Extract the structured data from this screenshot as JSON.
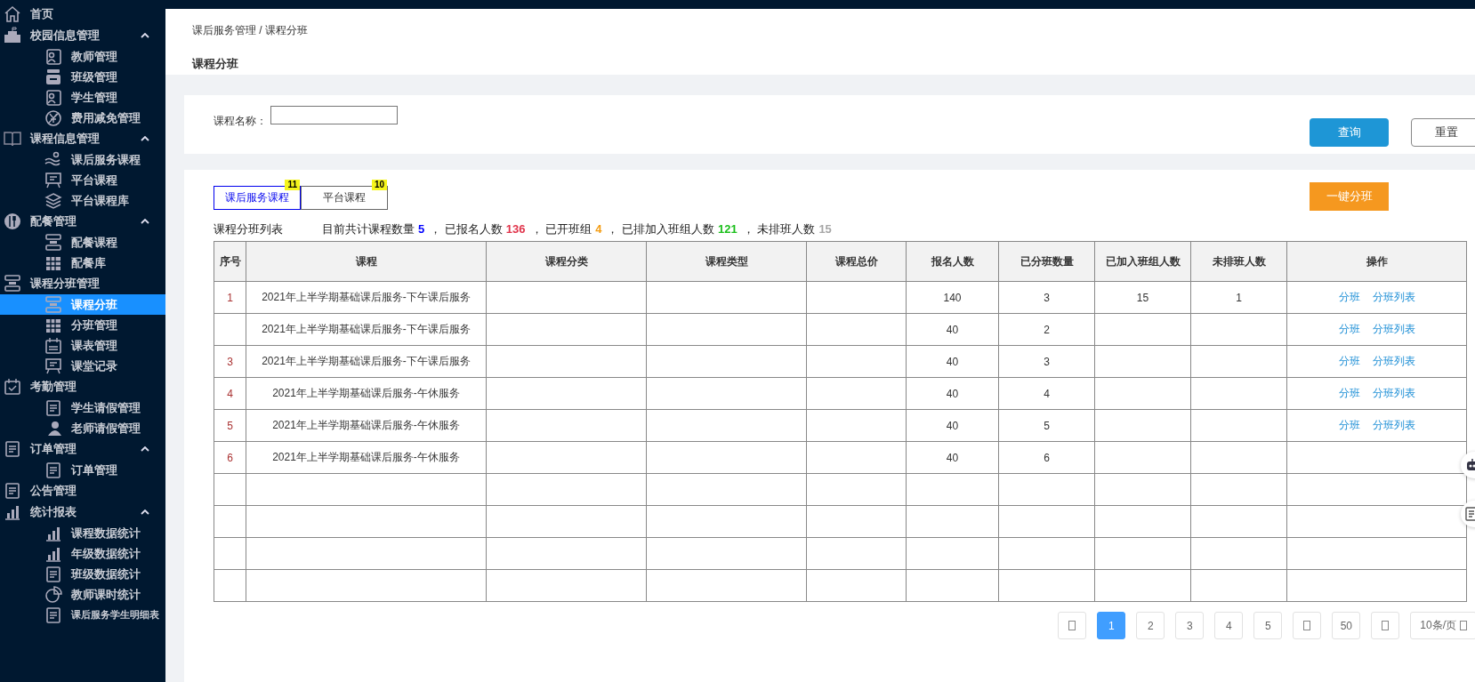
{
  "sidebar": {
    "items": [
      {
        "label": "首页"
      },
      {
        "label": "校园信息管理",
        "expanded": true,
        "children": [
          {
            "label": "教师管理",
            "selected": false
          },
          {
            "label": "班级管理",
            "selected": false
          },
          {
            "label": "学生管理",
            "selected": false
          },
          {
            "label": "费用减免管理",
            "selected": false
          }
        ]
      },
      {
        "label": "课程信息管理",
        "expanded": true,
        "children": [
          {
            "label": "课后服务课程",
            "selected": false
          },
          {
            "label": "平台课程",
            "selected": false
          },
          {
            "label": "平台课程库",
            "selected": false
          }
        ]
      },
      {
        "label": "配餐管理",
        "expanded": true,
        "children": [
          {
            "label": "配餐课程",
            "selected": false
          },
          {
            "label": "配餐库",
            "selected": false
          }
        ]
      },
      {
        "label": "课程分班管理",
        "children": [
          {
            "label": "课程分班",
            "selected": true
          },
          {
            "label": "分班管理",
            "selected": false
          },
          {
            "label": "课表管理",
            "selected": false
          },
          {
            "label": "课堂记录",
            "selected": false
          }
        ]
      },
      {
        "label": "考勤管理",
        "children": [
          {
            "label": "学生请假管理",
            "selected": false
          },
          {
            "label": "老师请假管理",
            "selected": false
          }
        ]
      },
      {
        "label": "订单管理",
        "expanded": true,
        "children": [
          {
            "label": "订单管理",
            "selected": false
          }
        ]
      },
      {
        "label": "公告管理"
      },
      {
        "label": "统计报表",
        "expanded": true,
        "children": [
          {
            "label": "课程数据统计",
            "selected": false
          },
          {
            "label": "年级数据统计",
            "selected": false
          },
          {
            "label": "班级数据统计",
            "selected": false
          },
          {
            "label": "教师课时统计",
            "selected": false
          },
          {
            "label": "课后服务学生明细表",
            "selected": false
          }
        ]
      }
    ]
  },
  "breadcrumb": "课后服务管理 / 课程分班",
  "page_title": "课程分班",
  "filter": {
    "label": "课程名称：",
    "buttons": [
      "查询",
      "重置"
    ]
  },
  "tabs": [
    {
      "label": "课后服务课程",
      "badge": "11",
      "selected": true
    },
    {
      "label": "平台课程",
      "badge": "10",
      "selected": false
    }
  ],
  "auto_assign_button": "一键分班",
  "list_title": "课程分班列表",
  "stats": [
    {
      "label": "目前共计课程数量",
      "value": "5",
      "color": "#0000ff"
    },
    {
      "label": "， 已报名人数",
      "value": "136",
      "color": "#e0334a"
    },
    {
      "label": "， 已开班组",
      "value": "4",
      "color": "#f39c12"
    },
    {
      "label": "， 已排加入班组人数",
      "value": "121",
      "color": "#1bbf1b"
    },
    {
      "label": "， 未排班人数",
      "value": "15",
      "color": "#a6a6a6"
    }
  ],
  "table": {
    "columns": [
      "序号",
      "课程",
      "课程分类",
      "课程类型",
      "课程总价",
      "报名人数",
      "已分班数量",
      "已加入班组人数",
      "未排班人数",
      "操作"
    ],
    "rows": [
      {
        "seq": "1",
        "course": "2021年上半学期基础课后服务-下午课后服务",
        "enrolled": "140",
        "classes": "3",
        "joined": "15",
        "unassigned": "1",
        "actions": [
          "分班",
          "分班列表"
        ]
      },
      {
        "course": "2021年上半学期基础课后服务-下午课后服务",
        "enrolled": "40",
        "classes": "2",
        "actions": [
          "分班",
          "分班列表"
        ]
      },
      {
        "seq": "3",
        "course": "2021年上半学期基础课后服务-下午课后服务",
        "enrolled": "40",
        "classes": "3",
        "actions": [
          "分班",
          "分班列表"
        ]
      },
      {
        "seq": "4",
        "course": "2021年上半学期基础课后服务-午休服务",
        "enrolled": "40",
        "classes": "4",
        "actions": [
          "分班",
          "分班列表"
        ]
      },
      {
        "seq": "5",
        "course": "2021年上半学期基础课后服务-午休服务",
        "enrolled": "40",
        "classes": "5",
        "actions": [
          "分班",
          "分班列表"
        ]
      },
      {
        "seq": "6",
        "course": "2021年上半学期基础课后服务-午休服务",
        "enrolled": "40",
        "classes": "6"
      }
    ]
  },
  "pagination": {
    "items": [
      {
        "kind": "prev"
      },
      {
        "kind": "page",
        "label": "1",
        "selected": true
      },
      {
        "kind": "page",
        "label": "2",
        "selected": false
      },
      {
        "kind": "page",
        "label": "3",
        "selected": false
      },
      {
        "kind": "page",
        "label": "4",
        "selected": false
      },
      {
        "kind": "page",
        "label": "5",
        "selected": false
      },
      {
        "kind": "more"
      },
      {
        "kind": "page",
        "label": "50",
        "selected": false
      },
      {
        "kind": "next"
      }
    ],
    "page_size": "10条/页"
  }
}
